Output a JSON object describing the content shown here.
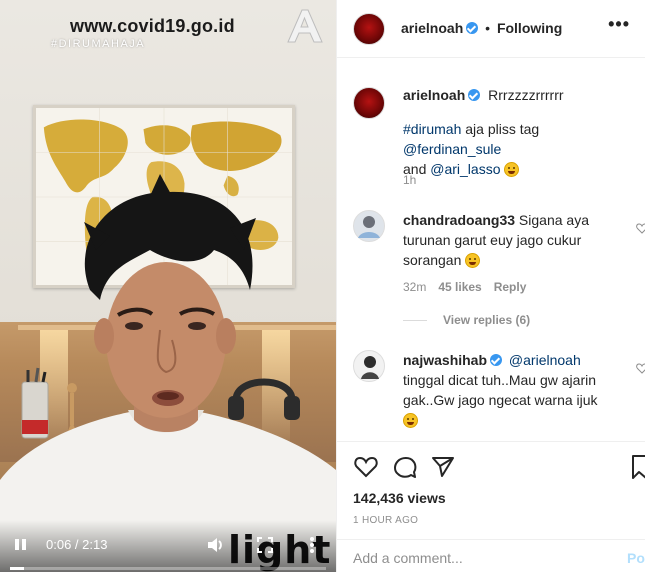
{
  "video": {
    "watermark": "www.covid19.go.id",
    "hashtag": "#DIRUMAHAJA",
    "shirt_text": "light",
    "time": "0:06 / 2:13",
    "progress": 0.045,
    "icons": [
      "pause-icon",
      "volume-icon",
      "fullscreen-icon",
      "more-vertical-icon"
    ]
  },
  "header": {
    "username": "arielnoah",
    "separator": "•",
    "follow_state": "Following",
    "more_label": "•••"
  },
  "caption": {
    "username": "arielnoah",
    "text": "Rrrzzzzrrrrrr",
    "hashtag": "#dirumah",
    "body1": " aja pliss tag ",
    "mention1": "@ferdinan_sule",
    "body2": "and ",
    "mention2": "@ari_lasso",
    "time": "1h"
  },
  "comments": [
    {
      "username": "chandradoang33",
      "text_line1": "Sigana aya",
      "text_line2": "turunan garut euy jago cukur",
      "text_line3": "sorangan",
      "time": "32m",
      "likes": "45 likes",
      "reply": "Reply",
      "view_replies": "View replies (6)"
    },
    {
      "username": "najwashihab",
      "mention": "@arielnoah",
      "text_line1": "tinggal dicat tuh..Mau gw ajarin",
      "text_line2": "gak..Gw jago ngecat warna ijuk"
    }
  ],
  "actions": {
    "views": "142,436 views",
    "ago": "1 HOUR AGO",
    "comment_placeholder": "Add a comment...",
    "post_label": "Post"
  },
  "colors": {
    "link": "#00376b",
    "verified": "#3897f0",
    "muted": "#8e8e8e",
    "post_disabled": "#b2dffc"
  }
}
